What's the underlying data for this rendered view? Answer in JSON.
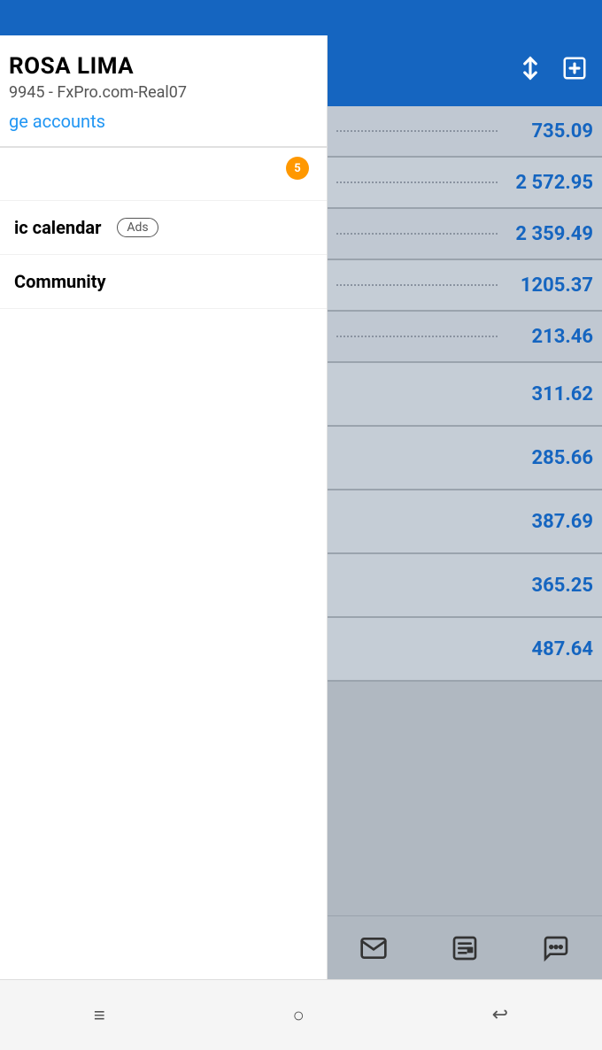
{
  "statusBar": {
    "backgroundColor": "#1565C0"
  },
  "leftPanel": {
    "userName": "ROSA LIMA",
    "accountId": "9945 - FxPro.com-Real07",
    "manageAccountsLabel": "ge accounts",
    "notificationCount": "5",
    "menuItems": [
      {
        "id": "economic-calendar",
        "label": "ic calendar",
        "hasAds": true,
        "adsBadgeLabel": "Ads"
      },
      {
        "id": "community",
        "label": "Community",
        "hasAds": false
      }
    ]
  },
  "rightPanel": {
    "header": {
      "sortIconLabel": "sort-icon",
      "addIconLabel": "add-icon"
    },
    "priceRows": [
      {
        "value": "735.09",
        "hasDots": true
      },
      {
        "value": "2 572.95",
        "hasDots": true
      },
      {
        "value": "2 359.49",
        "hasDots": true
      },
      {
        "value": "1205.37",
        "hasDots": true
      },
      {
        "value": "213.46",
        "hasDots": true
      },
      {
        "value": "311.62",
        "hasDots": false
      },
      {
        "value": "285.66",
        "hasDots": false
      },
      {
        "value": "387.69",
        "hasDots": false
      },
      {
        "value": "365.25",
        "hasDots": false
      },
      {
        "value": "487.64",
        "hasDots": false
      }
    ],
    "bottomTabs": [
      {
        "id": "inbox",
        "iconLabel": "inbox-icon"
      },
      {
        "id": "news",
        "iconLabel": "news-icon"
      },
      {
        "id": "chat",
        "iconLabel": "chat-icon"
      }
    ]
  },
  "androidNav": {
    "menuLabel": "≡",
    "homeLabel": "○",
    "backLabel": "↩"
  }
}
